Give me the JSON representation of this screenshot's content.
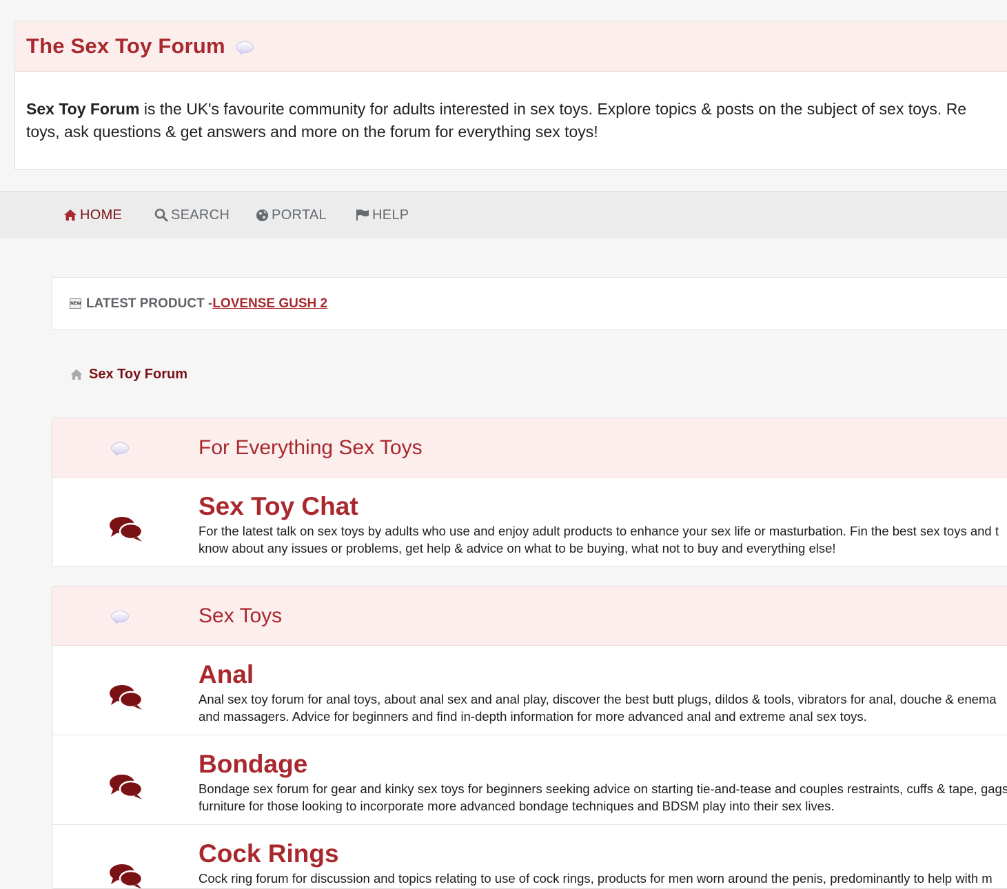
{
  "intro": {
    "title": "The Sex Toy Forum",
    "lead_bold": "Sex Toy Forum",
    "line1_rest": " is the UK's favourite community for adults interested in sex toys. Explore topics & posts on the subject of sex toys. Re",
    "line2": "toys, ask questions & get answers and more on the forum for everything sex toys!",
    "icon": "speech-bubble-icon"
  },
  "nav": {
    "home": "HOME",
    "search": "SEARCH",
    "portal": "PORTAL",
    "help": "HELP",
    "icons": [
      "home-icon",
      "search-icon",
      "globe-icon",
      "flag-icon"
    ]
  },
  "latest": {
    "badge": "NEW",
    "label": "LATEST PRODUCT - ",
    "product": "LOVENSE GUSH 2"
  },
  "breadcrumb": {
    "label": "Sex Toy Forum",
    "icon": "home-icon"
  },
  "categories": [
    {
      "title": "For Everything Sex Toys",
      "forums": [
        {
          "title": "Sex Toy Chat",
          "desc1": "For the latest talk on sex toys by adults who use and enjoy adult products to enhance your sex life or masturbation. Fin the best sex toys and t",
          "desc2": "know about any issues or problems, get help & advice on what to be buying, what not to buy and everything else!"
        }
      ]
    },
    {
      "title": "Sex Toys",
      "forums": [
        {
          "title": "Anal",
          "desc1": "Anal sex toy forum for anal toys, about anal sex and anal play, discover the best butt plugs, dildos & tools, vibrators for anal, douche & enema",
          "desc2": "and massagers. Advice for beginners and find in-depth information for more advanced anal and extreme anal sex toys."
        },
        {
          "title": "Bondage",
          "desc1": "Bondage sex forum for gear and kinky sex toys for beginners seeking advice on starting tie-and-tease and couples restraints, cuffs & tape, gags",
          "desc2": "furniture for those looking to incorporate more advanced bondage techniques and BDSM play into their sex lives."
        },
        {
          "title": "Cock Rings",
          "desc1": "Cock ring forum for discussion and topics relating to use of cock rings, products for men worn around the penis, predominantly to help with m",
          "desc2": ""
        }
      ]
    }
  ],
  "colors": {
    "brand": "#a8282d",
    "brand_dark": "#7a1114",
    "header_bg": "#fdeeee",
    "nav_bg": "#ececec",
    "page_bg": "#f6f6f6"
  }
}
